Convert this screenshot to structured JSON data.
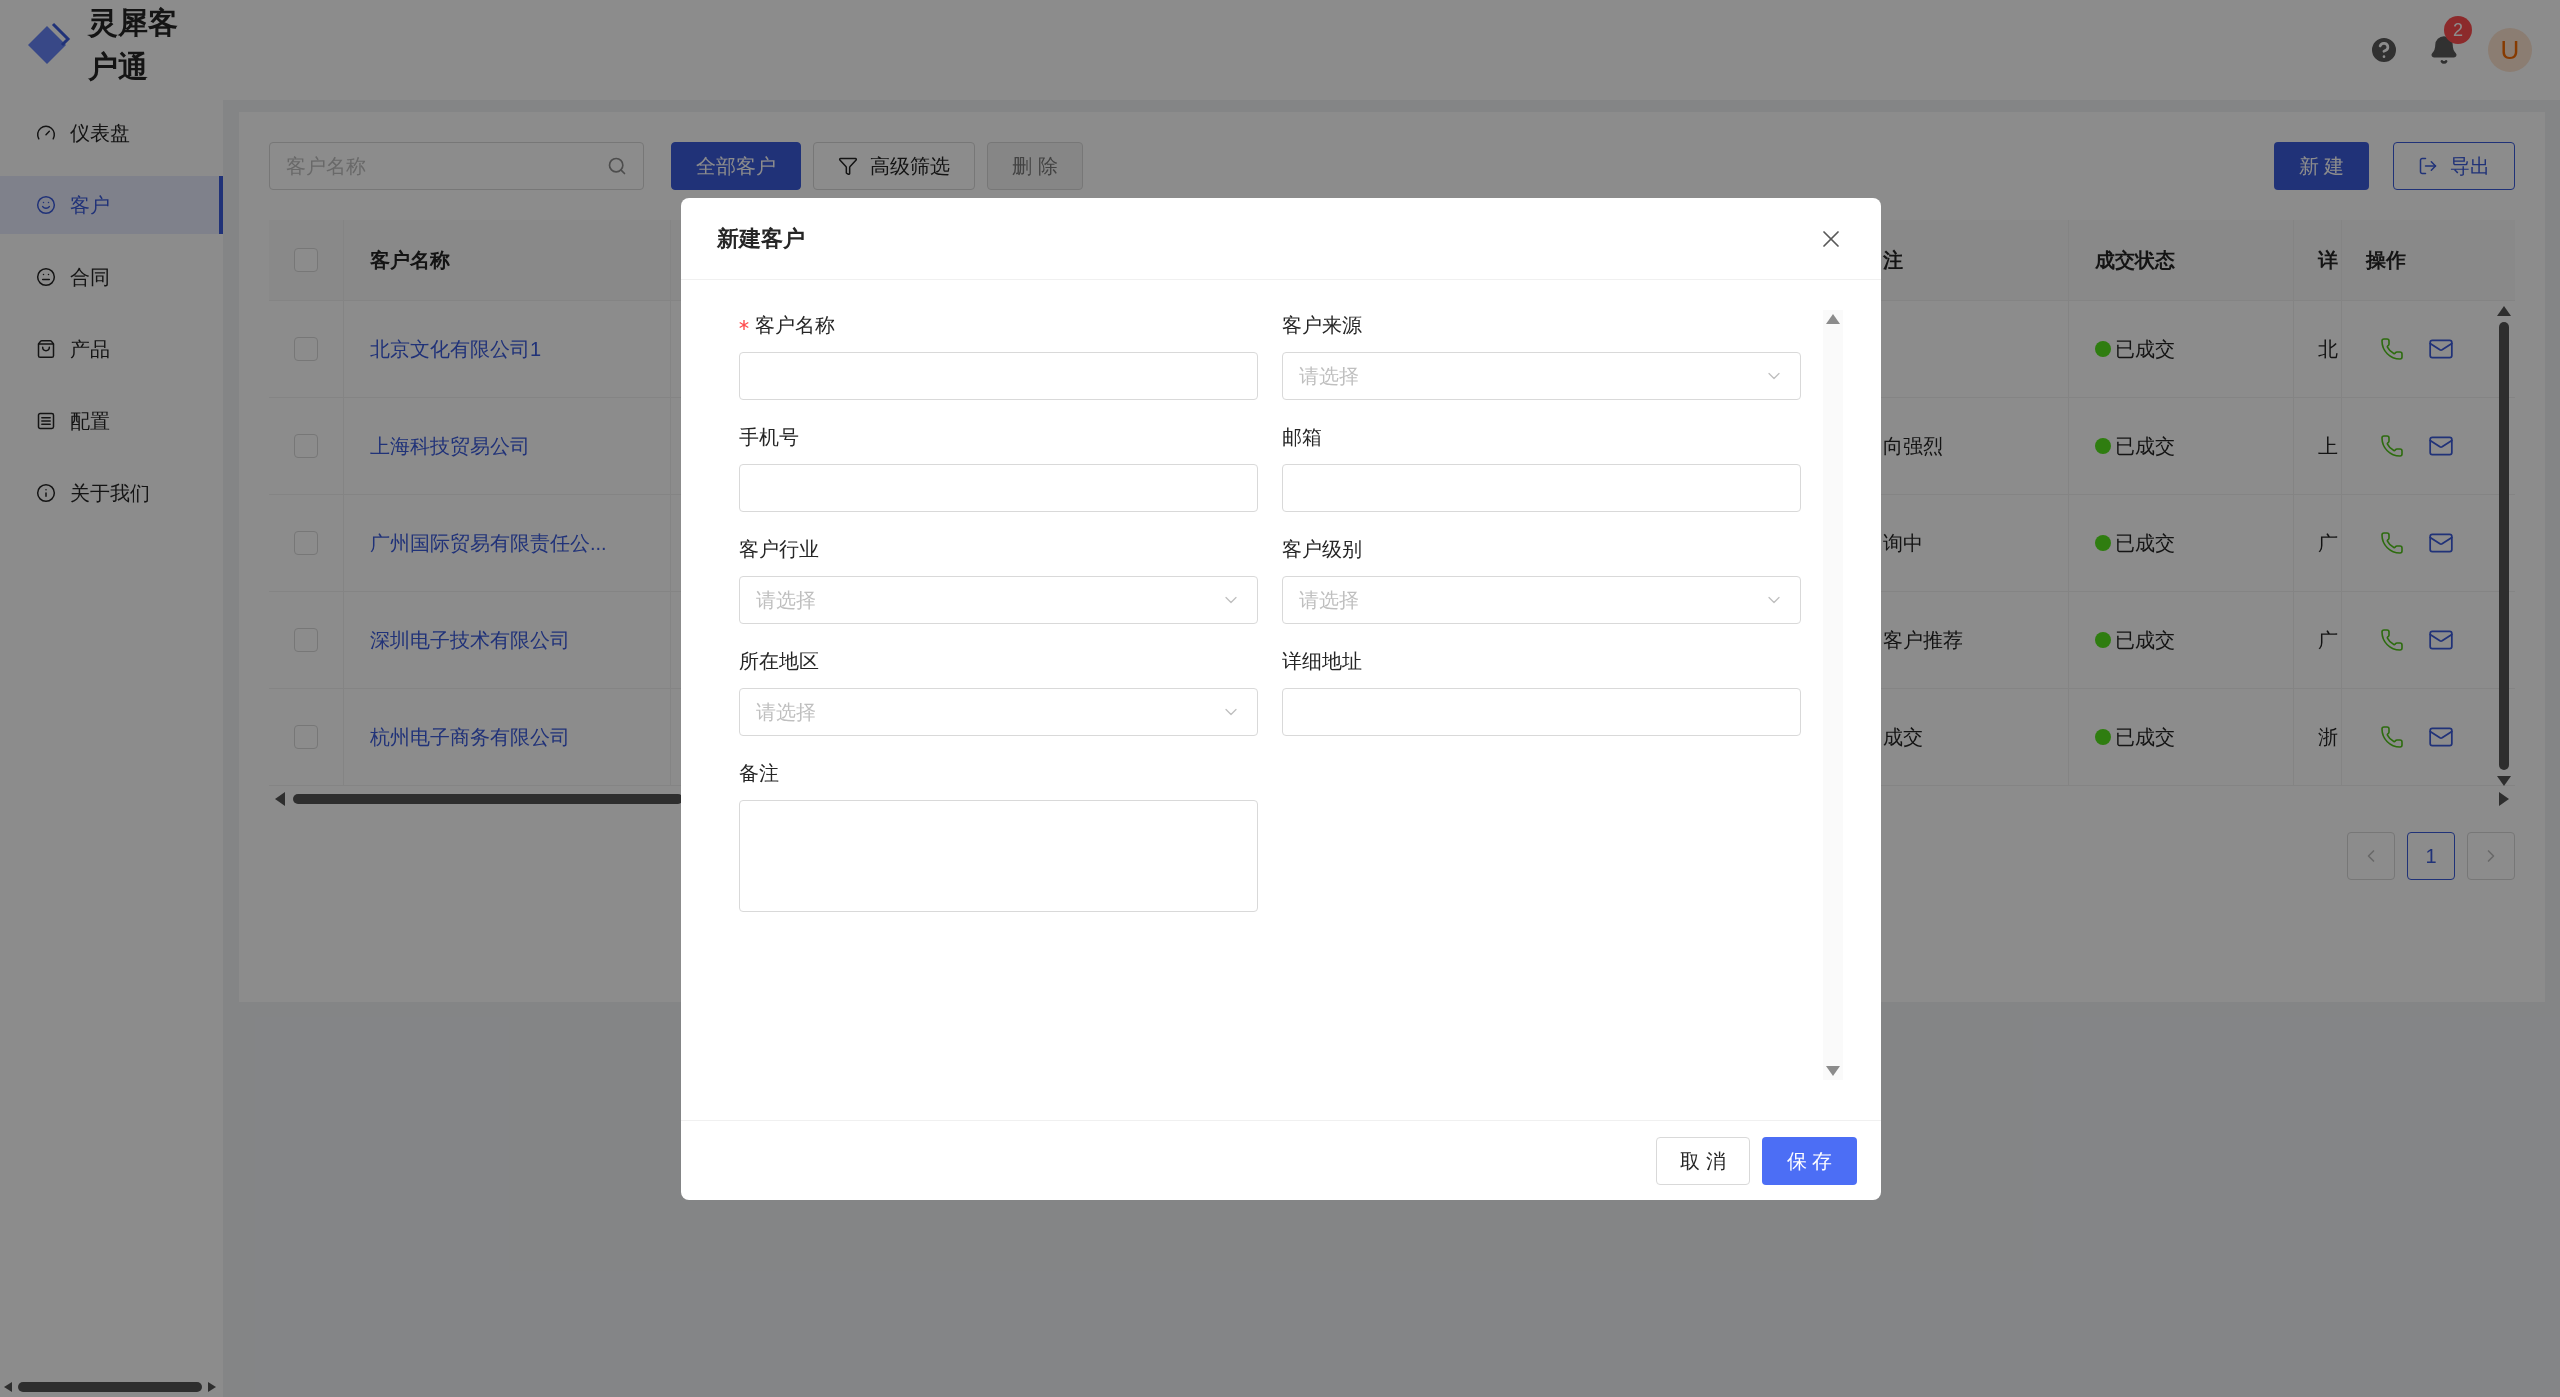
{
  "app": {
    "name": "灵犀客户通"
  },
  "sidebar": {
    "items": [
      {
        "label": "仪表盘",
        "selected": false
      },
      {
        "label": "客户",
        "selected": true
      },
      {
        "label": "合同",
        "selected": false
      },
      {
        "label": "产品",
        "selected": false
      },
      {
        "label": "配置",
        "selected": false
      },
      {
        "label": "关于我们",
        "selected": false
      }
    ]
  },
  "header": {
    "notifications": "2",
    "avatar": "U"
  },
  "toolbar": {
    "search": {
      "placeholder": "客户名称"
    },
    "filters": [
      {
        "label": "全部客户",
        "selected": true
      },
      {
        "label": "高级筛选",
        "selected": false
      }
    ],
    "delete": {
      "label": "删 除",
      "disabled": true
    },
    "new_button": "新 建",
    "export_button": "导出"
  },
  "table": {
    "all_checked": false,
    "columns": [
      "客户名称",
      "注",
      "成交状态",
      "详",
      "操作"
    ],
    "rows": [
      {
        "checked": false,
        "name": "北京文化有限公司1",
        "remark": "",
        "status": "已成交",
        "color": "#2f7d10",
        "detail": "北"
      },
      {
        "checked": false,
        "name": "上海科技贸易公司",
        "remark": "向强烈",
        "status": "已成交",
        "color": "#2f7d10",
        "detail": "上"
      },
      {
        "checked": false,
        "name": "广州国际贸易有限责任公...",
        "remark": "询中",
        "status": "已成交",
        "color": "#2f7d10",
        "detail": "广"
      },
      {
        "checked": false,
        "name": "深圳电子技术有限公司",
        "remark": "客户推荐",
        "status": "已成交",
        "color": "#2f7d10",
        "detail": "广"
      },
      {
        "checked": false,
        "name": "杭州电子商务有限公司",
        "remark": "成交",
        "status": "已成交",
        "color": "#2f7d10",
        "detail": "浙"
      }
    ]
  },
  "pagination": {
    "pages": [
      {
        "label": "1",
        "selected": true
      }
    ]
  },
  "dialog": {
    "title": "新建客户",
    "fields": [
      {
        "label": "客户名称",
        "kind": "input",
        "required": true
      },
      {
        "label": "客户来源",
        "kind": "select",
        "required": false,
        "placeholder": "请选择"
      },
      {
        "label": "手机号",
        "kind": "input",
        "required": false
      },
      {
        "label": "邮箱",
        "kind": "input",
        "required": false
      },
      {
        "label": "客户行业",
        "kind": "select",
        "required": false,
        "placeholder": "请选择"
      },
      {
        "label": "客户级别",
        "kind": "select",
        "required": false,
        "placeholder": "请选择"
      },
      {
        "label": "所在地区",
        "kind": "select",
        "required": false,
        "placeholder": "请选择"
      },
      {
        "label": "详细地址",
        "kind": "input",
        "required": false
      },
      {
        "label": "备注",
        "kind": "textarea",
        "required": false
      }
    ],
    "cancel_button": "取 消",
    "save_button": "保 存"
  }
}
